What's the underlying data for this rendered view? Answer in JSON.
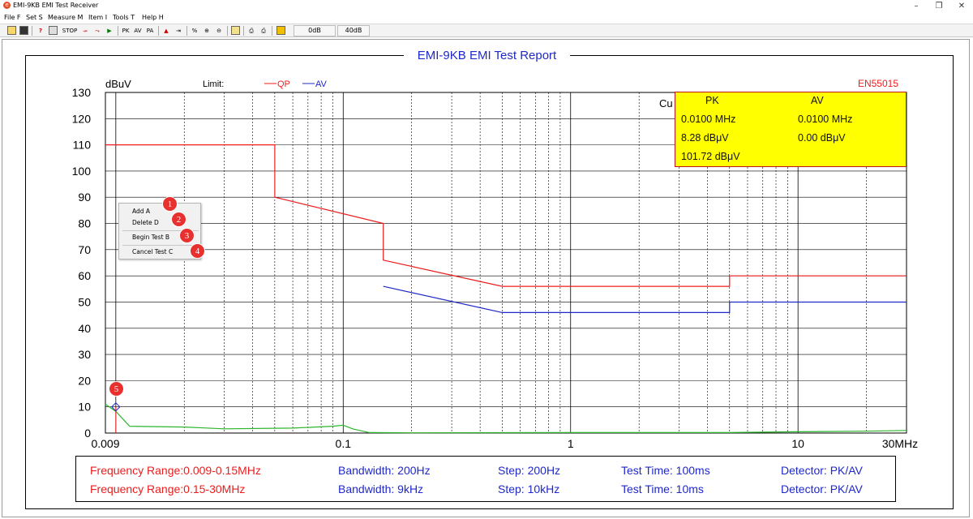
{
  "window": {
    "title": "EMI-9KB EMI Test Receiver",
    "app_icon": "app-logo-icon",
    "controls": [
      "minimize-icon",
      "restore-icon",
      "close-icon"
    ]
  },
  "menu": [
    "File F",
    "Set S",
    "Measure M",
    "Item I",
    "Tools T",
    "Help H"
  ],
  "toolbar": {
    "stop_label": "STOP",
    "pk_label": "PK",
    "av_label": "AV",
    "pa_label": "PA",
    "field1": "0dB",
    "field2": "40dB"
  },
  "report": {
    "title": "EMI-9KB EMI Test Report",
    "unit": "dBuV",
    "limit_label": "Limit:",
    "qp_label": "QP",
    "av_label": "AV",
    "standard": "EN55015",
    "cursor_label_partial": "Cu"
  },
  "cursor_panel": {
    "pk_header": "PK",
    "av_header": "AV",
    "pk_freq": "0.0100 MHz",
    "av_freq": "0.0100 MHz",
    "pk_level": "8.28 dBμV",
    "av_level": "0.00 dBμV",
    "extra": "101.72 dBμV"
  },
  "context_menu": {
    "items": [
      "Add A",
      "Delete D",
      "Begin Test B",
      "Cancel Test C"
    ],
    "badges": [
      "1",
      "2",
      "3",
      "4"
    ]
  },
  "marker_badge": "5",
  "settings": {
    "rows": [
      {
        "range": "Frequency Range:0.009-0.15MHz",
        "bandwidth": "Bandwidth: 200Hz",
        "step": "Step: 200Hz",
        "time": "Test Time: 100ms",
        "detector": "Detector: PK/AV"
      },
      {
        "range": "Frequency Range:0.15-30MHz",
        "bandwidth": "Bandwidth: 9kHz",
        "step": "Step: 10kHz",
        "time": "Test Time: 10ms",
        "detector": "Detector: PK/AV"
      }
    ]
  },
  "colors": {
    "qp": "#ee1c1c",
    "av": "#1f28c8",
    "measurement": "#2bb52b",
    "panel_bg": "#ffff00"
  },
  "chart_data": {
    "type": "line",
    "title": "EMI-9KB EMI Test Report",
    "ylabel": "dBuV",
    "x_scale": "log",
    "xlim": [
      0.009,
      30
    ],
    "ylim": [
      0,
      130
    ],
    "y_ticks": [
      0,
      10,
      20,
      30,
      40,
      50,
      60,
      70,
      80,
      90,
      100,
      110,
      120,
      130
    ],
    "x_tick_labels": [
      {
        "value": 0.009,
        "label": "0.009"
      },
      {
        "value": 0.1,
        "label": "0.1"
      },
      {
        "value": 1,
        "label": "1"
      },
      {
        "value": 10,
        "label": "10"
      },
      {
        "value": 30,
        "label": "30MHz"
      }
    ],
    "grid": true,
    "series": [
      {
        "name": "QP",
        "color": "#ee1c1c",
        "points": [
          [
            0.009,
            110
          ],
          [
            0.05,
            110
          ],
          [
            0.05,
            90
          ],
          [
            0.15,
            80
          ],
          [
            0.15,
            66
          ],
          [
            0.5,
            56
          ],
          [
            5,
            56
          ],
          [
            5,
            60
          ],
          [
            30,
            60
          ]
        ]
      },
      {
        "name": "AV",
        "color": "#1f28c8",
        "points": [
          [
            0.15,
            56
          ],
          [
            0.5,
            46
          ],
          [
            5,
            46
          ],
          [
            5,
            50
          ],
          [
            30,
            50
          ]
        ]
      },
      {
        "color": "#2bb52b",
        "points": [
          [
            0.009,
            11
          ],
          [
            0.01,
            8.3
          ],
          [
            0.0115,
            2.6
          ],
          [
            0.02,
            2.3
          ],
          [
            0.03,
            1.6
          ],
          [
            0.06,
            1.9
          ],
          [
            0.09,
            2.6
          ],
          [
            0.1,
            3.0
          ],
          [
            0.11,
            1.6
          ],
          [
            0.13,
            0.2
          ],
          [
            0.2,
            0.1
          ],
          [
            1,
            0.2
          ],
          [
            5,
            0.2
          ],
          [
            10,
            0.5
          ],
          [
            20,
            0.7
          ],
          [
            30,
            1.0
          ]
        ]
      }
    ],
    "marker": {
      "x": 0.01,
      "y": 10
    }
  }
}
